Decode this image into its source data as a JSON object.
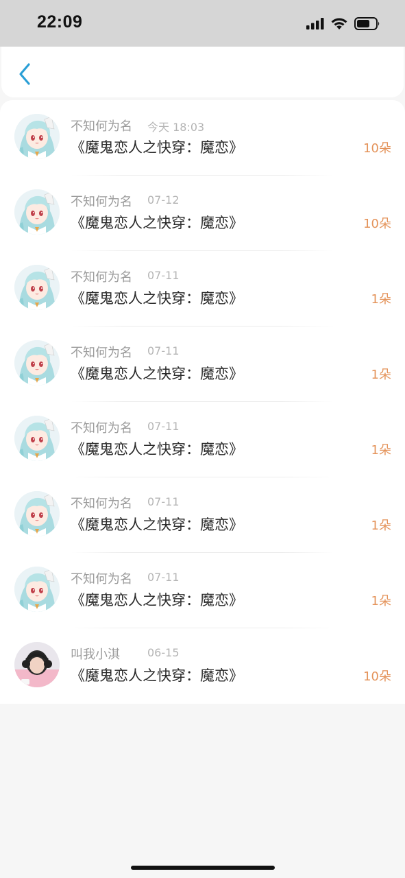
{
  "status_bar": {
    "time": "22:09",
    "icons": [
      "signal-icon",
      "wifi-icon",
      "battery-icon"
    ]
  },
  "nav": {
    "back_icon": "chevron-left-icon",
    "accent": "#2a9fd6"
  },
  "items": [
    {
      "name": "不知何为名",
      "time": "今天 18:03",
      "title": "《魔鬼恋人之快穿：魔恋》",
      "amount": "10朵",
      "avatar": "anime-girl-avatar"
    },
    {
      "name": "不知何为名",
      "time": "07-12",
      "title": "《魔鬼恋人之快穿：魔恋》",
      "amount": "10朵",
      "avatar": "anime-girl-avatar"
    },
    {
      "name": "不知何为名",
      "time": "07-11",
      "title": "《魔鬼恋人之快穿：魔恋》",
      "amount": "1朵",
      "avatar": "anime-girl-avatar"
    },
    {
      "name": "不知何为名",
      "time": "07-11",
      "title": "《魔鬼恋人之快穿：魔恋》",
      "amount": "1朵",
      "avatar": "anime-girl-avatar"
    },
    {
      "name": "不知何为名",
      "time": "07-11",
      "title": "《魔鬼恋人之快穿：魔恋》",
      "amount": "1朵",
      "avatar": "anime-girl-avatar"
    },
    {
      "name": "不知何为名",
      "time": "07-11",
      "title": "《魔鬼恋人之快穿：魔恋》",
      "amount": "1朵",
      "avatar": "anime-girl-avatar"
    },
    {
      "name": "不知何为名",
      "time": "07-11",
      "title": "《魔鬼恋人之快穿：魔恋》",
      "amount": "1朵",
      "avatar": "anime-girl-avatar"
    },
    {
      "name": "叫我小淇",
      "time": "06-15",
      "title": "《魔鬼恋人之快穿：魔恋》",
      "amount": "10朵",
      "avatar": "photo-avatar"
    }
  ],
  "colors": {
    "amount": "#e4935a",
    "name": "#9b9b9b",
    "title": "#2a2a2a"
  }
}
